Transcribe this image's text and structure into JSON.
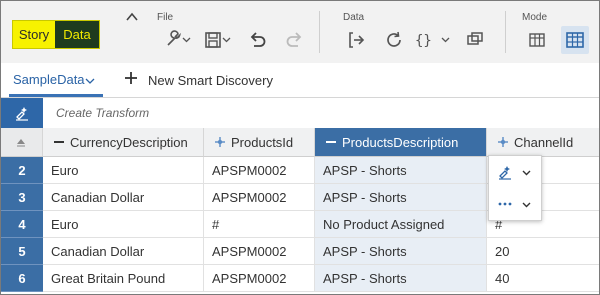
{
  "mode": {
    "story_label": "Story",
    "data_label": "Data"
  },
  "toolbar": {
    "file_label": "File",
    "data_label": "Data",
    "mode_label": "Mode"
  },
  "tabs": {
    "active_label": "SampleData",
    "new_discovery_label": "New Smart Discovery"
  },
  "transform": {
    "placeholder": "Create Transform"
  },
  "grid": {
    "columns": [
      {
        "label": "CurrencyDescription",
        "icon": "minus-icon"
      },
      {
        "label": "ProductsId",
        "icon": "move-icon"
      },
      {
        "label": "ProductsDescription",
        "icon": "minus-icon",
        "selected": true
      },
      {
        "label": "ChannelId",
        "icon": "move-icon"
      }
    ],
    "rows": [
      {
        "num": "2",
        "cells": [
          "Euro",
          "APSPM0002",
          "APSP - Shorts",
          ""
        ]
      },
      {
        "num": "3",
        "cells": [
          "Canadian Dollar",
          "APSPM0002",
          "APSP - Shorts",
          ""
        ]
      },
      {
        "num": "4",
        "cells": [
          "Euro",
          "#",
          "No Product Assigned",
          "#"
        ]
      },
      {
        "num": "5",
        "cells": [
          "Canadian Dollar",
          "APSPM0002",
          "APSP - Shorts",
          "20"
        ]
      },
      {
        "num": "6",
        "cells": [
          "Great Britain Pound",
          "APSPM0002",
          "APSP - Shorts",
          "40"
        ]
      }
    ]
  },
  "colors": {
    "accent": "#3b6ea5",
    "story_yellow": "#f7f200",
    "data_dark": "#1e3b1e"
  }
}
